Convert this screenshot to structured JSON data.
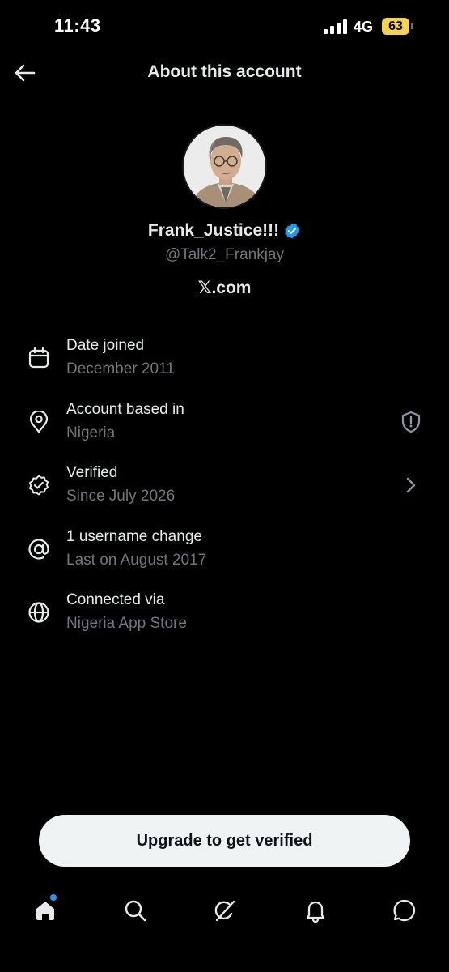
{
  "status_bar": {
    "time": "11:43",
    "network": "4G",
    "battery": "63"
  },
  "header": {
    "title": "About this account",
    "back_icon": "arrow-left-icon"
  },
  "profile": {
    "display_name": "Frank_Justice!!!",
    "handle": "@Talk2_Frankjay",
    "site": "𝕏.com",
    "verified_badge_color": "#1d9bf0"
  },
  "info_rows": [
    {
      "icon": "calendar-icon",
      "title": "Date joined",
      "subtitle": "December 2011"
    },
    {
      "icon": "location-pin-icon",
      "title": "Account based in",
      "subtitle": "Nigeria",
      "trailing_icon": "shield-alert-icon"
    },
    {
      "icon": "verified-badge-icon",
      "title": "Verified",
      "subtitle": "Since July 2026",
      "trailing_icon": "chevron-right-icon"
    },
    {
      "icon": "at-sign-icon",
      "title": "1 username change",
      "subtitle": "Last on August 2017"
    },
    {
      "icon": "globe-icon",
      "title": "Connected via",
      "subtitle": "Nigeria App Store"
    }
  ],
  "upgrade_button": {
    "label": "Upgrade to get verified"
  },
  "bottom_nav": {
    "items": [
      "home-icon",
      "search-icon",
      "grok-icon",
      "notifications-bell-icon",
      "messages-icon"
    ],
    "accent_color": "#1d9bf0"
  }
}
